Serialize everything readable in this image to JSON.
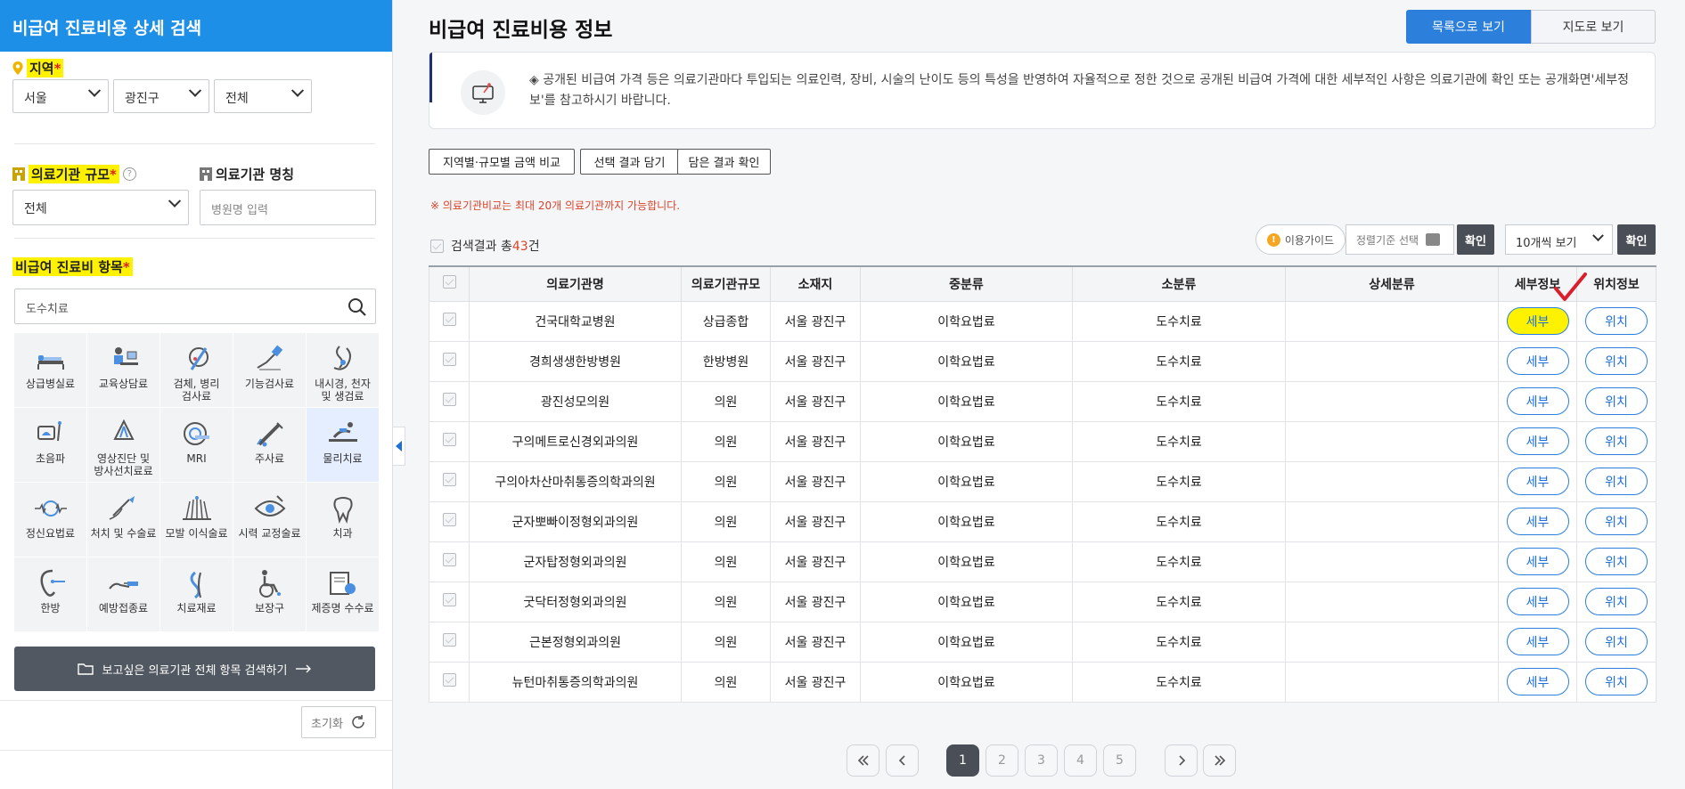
{
  "sidebar": {
    "title": "비급여 진료비용 상세 검색",
    "region_label": "지역",
    "region_selects": [
      "서울",
      "광진구",
      "전체"
    ],
    "scale_label": "의료기관 규모",
    "scale_select": "전체",
    "name_label": "의료기관 명칭",
    "name_placeholder": "병원명 입력",
    "items_label": "비급여 진료비 항목",
    "items_placeholder": "도수치료",
    "required_mark": "*",
    "help_mark": "?",
    "categories": [
      {
        "label": "상급병실료",
        "icon": "hospital-bed-icon"
      },
      {
        "label": "교육상담료",
        "icon": "counseling-desk-icon"
      },
      {
        "label": "검체, 병리\n검사료",
        "icon": "specimen-test-icon"
      },
      {
        "label": "기능검사료",
        "icon": "function-test-icon"
      },
      {
        "label": "내시경, 천자\n및 생검료",
        "icon": "endoscope-icon"
      },
      {
        "label": "초음파",
        "icon": "ultrasound-icon"
      },
      {
        "label": "영상진단 및\n방사선치료료",
        "icon": "imaging-icon"
      },
      {
        "label": "MRI",
        "icon": "mri-icon"
      },
      {
        "label": "주사료",
        "icon": "syringe-icon"
      },
      {
        "label": "물리치료",
        "icon": "physical-therapy-icon"
      },
      {
        "label": "정신요법료",
        "icon": "brainwave-icon"
      },
      {
        "label": "처치 및 수술료",
        "icon": "scalpel-icon"
      },
      {
        "label": "모발 이식술료",
        "icon": "hair-transplant-icon"
      },
      {
        "label": "시력 교정술료",
        "icon": "eye-icon"
      },
      {
        "label": "치과",
        "icon": "tooth-icon"
      },
      {
        "label": "한방",
        "icon": "acupuncture-ear-icon"
      },
      {
        "label": "예방접종료",
        "icon": "vaccine-arm-icon"
      },
      {
        "label": "치료재료",
        "icon": "medical-material-icon"
      },
      {
        "label": "보장구",
        "icon": "wheelchair-icon"
      },
      {
        "label": "제증명 수수료",
        "icon": "certificate-icon"
      }
    ],
    "active_category": "물리치료",
    "search_all_label": "보고싶은 의료기관 전체 항목 검색하기",
    "reset_label": "초기화"
  },
  "main": {
    "title": "비급여 진료비용 정보",
    "view_toggle": {
      "list": "목록으로 보기",
      "map": "지도로 보기"
    },
    "notice": "◈ 공개된 비급여 가격 등은 의료기관마다 투입되는 의료인력, 장비, 시술의 난이도 등의 특성을 반영하여 자율적으로 정한 것으로 공개된 비급여 가격에 대한 세부적인 사항은 의료기관에 확인 또는 공개화면'세부정보'를 참고하시기 바랍니다.",
    "actions": [
      "지역별·규모별 금액 비교",
      "선택 결과 담기",
      "담은 결과 확인"
    ],
    "warning": "※ 의료기관비교는 최대 20개 의료기관까지 가능합니다.",
    "result_prefix": "검색결과 총",
    "result_count": "43",
    "result_suffix": "건",
    "guide_label": "이용가이드",
    "guide_mark": "!",
    "sort_placeholder": "정렬기준 선택",
    "confirm_label": "확인",
    "per_page": "10개씩 보기",
    "columns": [
      "의료기관명",
      "의료기관규모",
      "소재지",
      "중분류",
      "소분류",
      "상세분류",
      "세부정보",
      "위치정보"
    ],
    "detail_btn": "세부",
    "location_btn": "위치",
    "rows": [
      {
        "name": "건국대학교병원",
        "scale": "상급종합",
        "location": "서울 광진구",
        "mid": "이학요법료",
        "sub": "도수치료",
        "detail": ""
      },
      {
        "name": "경희생생한방병원",
        "scale": "한방병원",
        "location": "서울 광진구",
        "mid": "이학요법료",
        "sub": "도수치료",
        "detail": ""
      },
      {
        "name": "광진성모의원",
        "scale": "의원",
        "location": "서울 광진구",
        "mid": "이학요법료",
        "sub": "도수치료",
        "detail": ""
      },
      {
        "name": "구의메트로신경외과의원",
        "scale": "의원",
        "location": "서울 광진구",
        "mid": "이학요법료",
        "sub": "도수치료",
        "detail": ""
      },
      {
        "name": "구의아차산마취통증의학과의원",
        "scale": "의원",
        "location": "서울 광진구",
        "mid": "이학요법료",
        "sub": "도수치료",
        "detail": ""
      },
      {
        "name": "군자뽀빠이정형외과의원",
        "scale": "의원",
        "location": "서울 광진구",
        "mid": "이학요법료",
        "sub": "도수치료",
        "detail": ""
      },
      {
        "name": "군자탑정형외과의원",
        "scale": "의원",
        "location": "서울 광진구",
        "mid": "이학요법료",
        "sub": "도수치료",
        "detail": ""
      },
      {
        "name": "굿닥터정형외과의원",
        "scale": "의원",
        "location": "서울 광진구",
        "mid": "이학요법료",
        "sub": "도수치료",
        "detail": ""
      },
      {
        "name": "근본정형외과의원",
        "scale": "의원",
        "location": "서울 광진구",
        "mid": "이학요법료",
        "sub": "도수치료",
        "detail": ""
      },
      {
        "name": "뉴턴마취통증의학과의원",
        "scale": "의원",
        "location": "서울 광진구",
        "mid": "이학요법료",
        "sub": "도수치료",
        "detail": ""
      }
    ],
    "pagination": {
      "pages": [
        "1",
        "2",
        "3",
        "4",
        "5"
      ],
      "current": "1"
    }
  },
  "colors": {
    "accent": "#1e8fe6",
    "primary_button": "#2d7fdc",
    "highlight": "#fff200",
    "warning": "#d9432b",
    "dark_button": "#4a4f57",
    "check_mark": "#d91f2e"
  }
}
